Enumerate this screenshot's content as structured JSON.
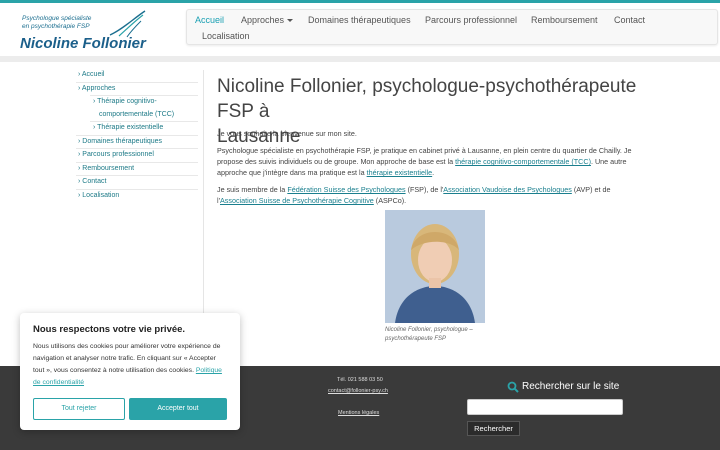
{
  "site": {
    "logo_tagline_1": "Psychologue spécialiste",
    "logo_tagline_2": "en psychothérapie FSP",
    "logo_name": "Nicoline Follonier",
    "accent_color": "#2aa3a8"
  },
  "nav": {
    "items": [
      {
        "label": "Accueil"
      },
      {
        "label": "Approches"
      },
      {
        "label": "Domaines thérapeutiques"
      },
      {
        "label": "Parcours professionnel"
      },
      {
        "label": "Remboursement"
      },
      {
        "label": "Contact"
      },
      {
        "label": "Localisation"
      }
    ],
    "active": "Accueil"
  },
  "sidebar": {
    "items": [
      {
        "label": "Accueil"
      },
      {
        "label": "Approches"
      },
      {
        "label": "Thérapie cognitivo-"
      },
      {
        "label": "comportementale (TCC)"
      },
      {
        "label": "Thérapie existentielle"
      },
      {
        "label": "Domaines thérapeutiques"
      },
      {
        "label": "Parcours professionnel"
      },
      {
        "label": "Remboursement"
      },
      {
        "label": "Contact"
      },
      {
        "label": "Localisation"
      }
    ]
  },
  "main": {
    "title_line1": "Nicoline Follonier, psychologue-psychothérapeute FSP à",
    "title_line2": "Lausanne",
    "p1": "Je vous souhaite la bienvenue sur mon site.",
    "p2_a": "Psychologue spécialiste en psychothérapie FSP, je pratique en cabinet privé à Lausanne, en plein centre du quartier de Chailly. Je propose des suivis individuels ou de groupe. Mon approche de base est la ",
    "p2_link1": "thérapie cognitivo-comportementale (TCC)",
    "p2_b": ". Une autre approche que j'intègre dans ma pratique est la ",
    "p2_link2": "thérapie existentielle",
    "p2_c": ".",
    "p3_a": "Je suis membre de la ",
    "p3_link1": "Fédération Suisse des Psychologues",
    "p3_b": " (FSP), de l'",
    "p3_link2": "Association Vaudoise des Psychologues",
    "p3_c": " (AVP) et de l'",
    "p3_link3": "Association Suisse de Psychothérapie Cognitive",
    "p3_d": " (ASPCo).",
    "caption": "Nicoline Follonier, psychologue – psychothérapeute FSP"
  },
  "footer": {
    "tel": "Tél. 021 588 03 50",
    "email": "contact@follonier-psy.ch",
    "legal": "Mentions légales",
    "search_title": "Rechercher sur le site",
    "search_button": "Rechercher"
  },
  "cookie": {
    "title": "Nous respectons votre vie privée.",
    "body": "Nous utilisons des cookies pour améliorer votre expérience de navigation et analyser notre trafic. En cliquant sur « Accepter tout », vous consentez à notre utilisation des cookies. ",
    "policy_link": "Politique de confidentialité",
    "reject": "Tout rejeter",
    "accept": "Accepter tout"
  }
}
